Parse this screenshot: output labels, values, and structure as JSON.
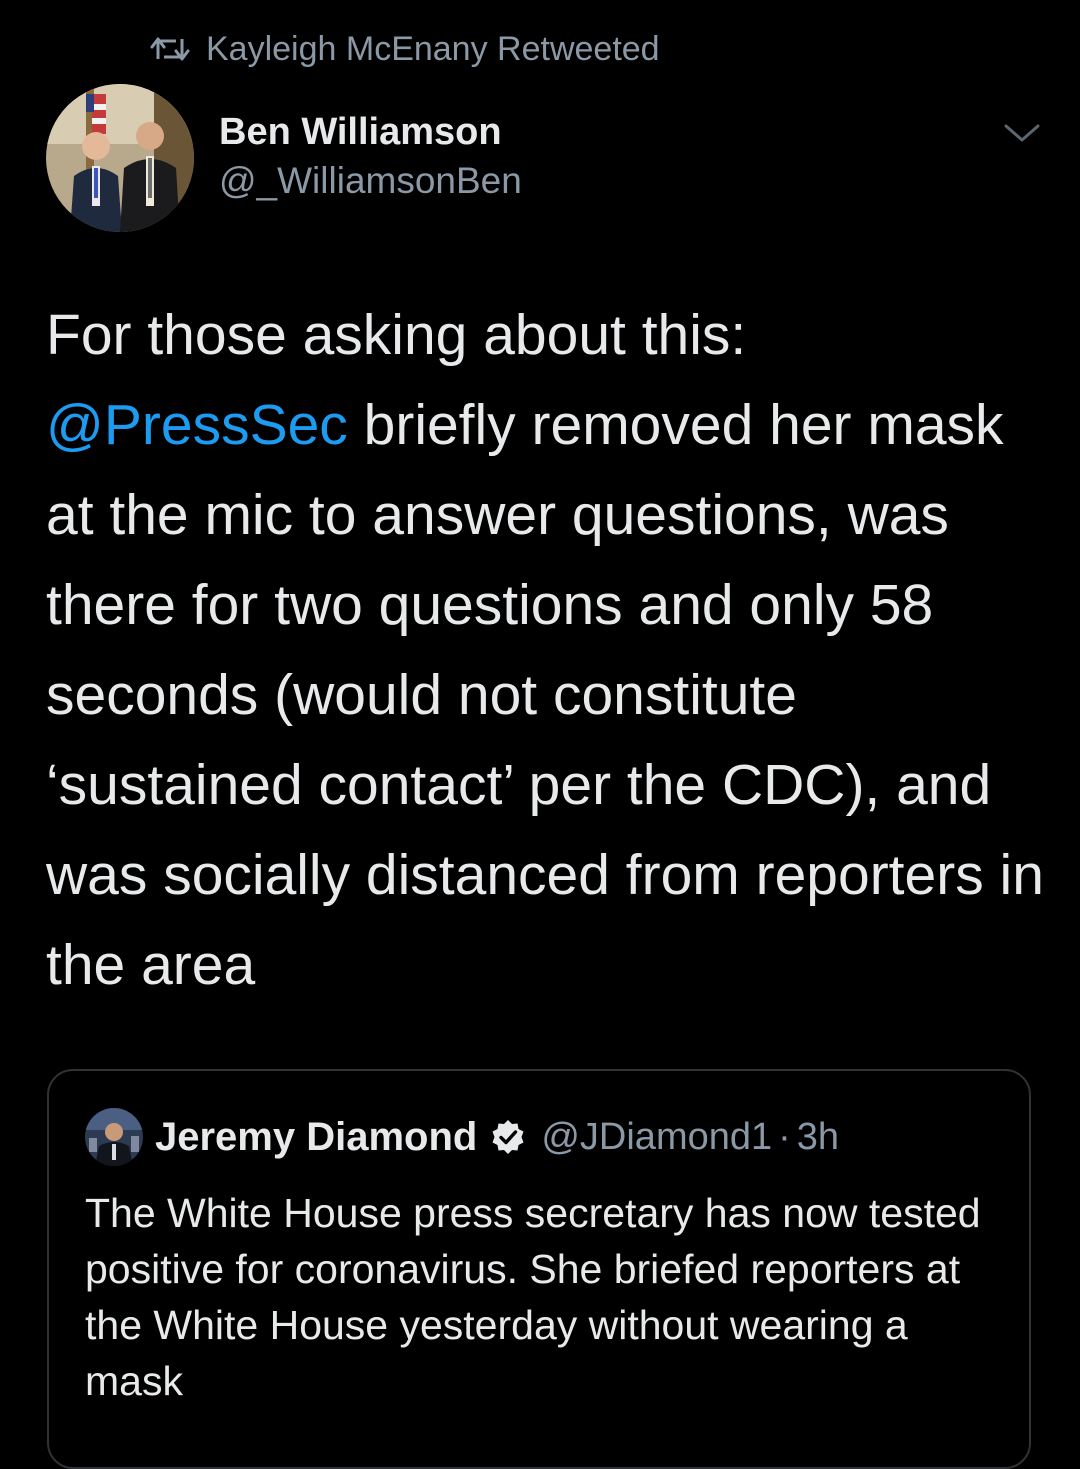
{
  "retweet": {
    "label": "Kayleigh McEnany Retweeted",
    "icon": "retweet-icon"
  },
  "tweet": {
    "author_name": "Ben Williamson",
    "author_handle": "@_WilliamsonBen",
    "text_before_mention": "For those asking about this: ",
    "mention": "@PressSec",
    "text_after_mention": " briefly removed her mask at the mic to answer questions, was there for two questions and only 58 seconds (would not constitute ‘sustained contact’ per the CDC), and was socially distanced from reporters in the area",
    "menu_icon": "chevron-down-icon"
  },
  "quoted_tweet": {
    "author_name": "Jeremy Diamond",
    "verified_icon": "verified-badge-icon",
    "author_handle": "@JDiamond1",
    "separator": "·",
    "time": "3h",
    "text": "The White House press secretary has now tested positive for coronavirus. She briefed reporters at the White House yesterday without wearing a mask"
  },
  "colors": {
    "background": "#000000",
    "text": "#e7e9ea",
    "secondary_text": "#8b98a5",
    "mention": "#1d9bf0",
    "card_border": "#2f3336"
  }
}
